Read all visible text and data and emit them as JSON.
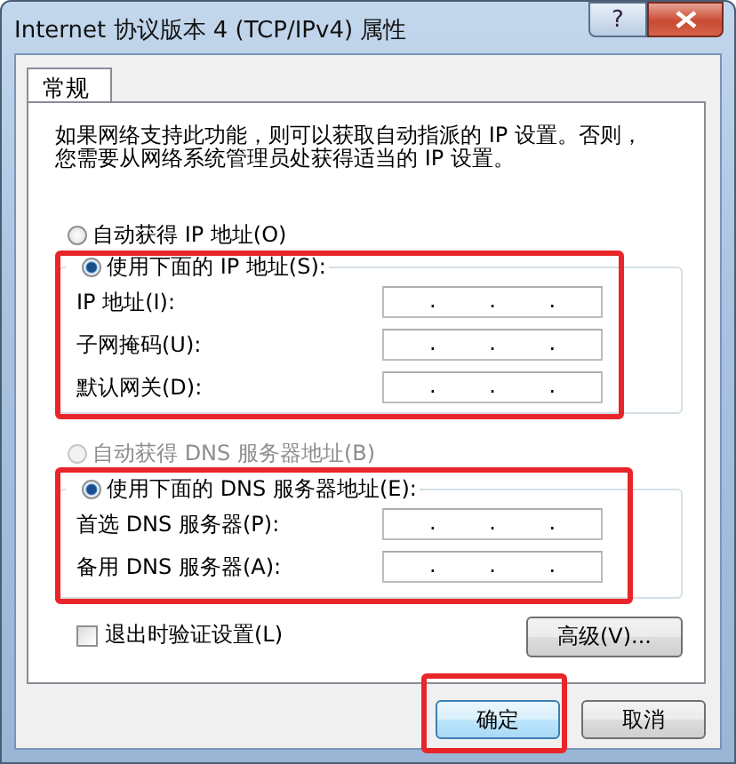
{
  "window": {
    "title": "Internet 协议版本 4 (TCP/IPv4) 属性",
    "controls": [
      {
        "kind": "help",
        "label": "?"
      },
      {
        "kind": "close"
      }
    ]
  },
  "tabs": [
    {
      "label": "常规",
      "selected": true
    }
  ],
  "description": "如果网络支持此功能，则可以获取自动指派的 IP 设置。否则，您需要从网络系统管理员处获得适当的 IP 设置。",
  "ip": {
    "auto": {
      "label": "自动获得 IP 地址(O)",
      "selected": false,
      "disabled": false
    },
    "manual": {
      "label": "使用下面的 IP 地址(S):",
      "selected": true,
      "disabled": false,
      "highlighted": true
    },
    "fields": [
      {
        "label": "IP 地址(I):",
        "value": ". . ."
      },
      {
        "label": "子网掩码(U):",
        "value": ". . ."
      },
      {
        "label": "默认网关(D):",
        "value": ". . ."
      }
    ]
  },
  "dns": {
    "auto": {
      "label": "自动获得 DNS 服务器地址(B)",
      "selected": false,
      "disabled": true
    },
    "manual": {
      "label": "使用下面的 DNS 服务器地址(E):",
      "selected": true,
      "disabled": false,
      "highlighted": true
    },
    "fields": [
      {
        "label": "首选 DNS 服务器(P):",
        "value": ". . ."
      },
      {
        "label": "备用 DNS 服务器(A):",
        "value": ". . ."
      }
    ]
  },
  "validate": {
    "label": "退出时验证设置(L)",
    "checked": false
  },
  "advanced_button": "高级(V)...",
  "buttons": [
    {
      "label": "确定",
      "highlighted": true
    },
    {
      "label": "取消",
      "highlighted": false
    }
  ]
}
